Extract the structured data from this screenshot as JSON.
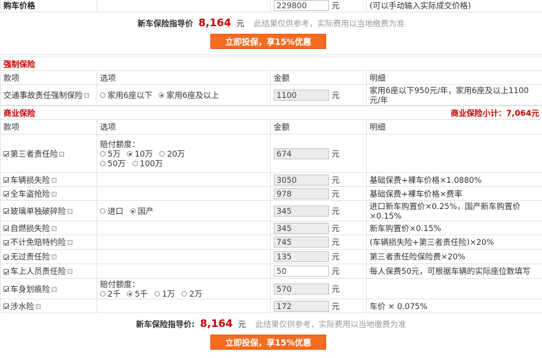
{
  "car_price": {
    "label": "购车价格",
    "value": "229800",
    "unit": "元",
    "hint": "(可以手动输入实际成交价格)"
  },
  "top_banner": {
    "label": "新车保险指导价",
    "price": "8,164",
    "unit": "元",
    "note": "此结果仅供参考，实际费用以当地缴费为准",
    "button": "立即投保，享15%优惠"
  },
  "compulsory": {
    "title": "强制保险",
    "headers": [
      "款项",
      "选项",
      "金额",
      "明细"
    ],
    "name": "交通事故责任强制保险",
    "options": [
      "家用6座以下",
      "家用6座及以上"
    ],
    "selected": 1,
    "amount": "1100",
    "unit": "元",
    "detail": "家用6座以下950元/年，家用6座及以上1100元/年"
  },
  "commercial": {
    "title": "商业保险",
    "subtotal": "商业保险小计：7,064元",
    "headers": [
      "款项",
      "选项",
      "金额",
      "明细"
    ],
    "unit": "元",
    "third_party": {
      "name": "第三者责任险",
      "caption": "赔付额度：",
      "options": [
        "5万",
        "10万",
        "20万",
        "50万",
        "100万"
      ],
      "selected": 1,
      "amount": "674"
    },
    "vehicle_loss": {
      "name": "车辆损失险",
      "amount": "3050",
      "detail": "基础保费+裸车价格×1.0880%"
    },
    "theft": {
      "name": "全车盗抢险",
      "amount": "978",
      "detail": "基础保费+裸车价格×费率"
    },
    "glass": {
      "name": "玻璃单独破碎险",
      "options": [
        "进口",
        "国产"
      ],
      "selected": 1,
      "amount": "345",
      "detail": "进口新车购置价×0.25%，国产新车购置价×0.15%"
    },
    "fire": {
      "name": "自燃损失险",
      "amount": "345",
      "detail": "新车购置价×0.15%"
    },
    "deductible": {
      "name": "不计免赔特约险",
      "amount": "745",
      "detail": "(车辆损失险+第三者责任险)×20%"
    },
    "no_fault": {
      "name": "无过责任险",
      "amount": "135",
      "detail": "第三者责任险保险费×20%"
    },
    "passenger": {
      "name": "车上人员责任险",
      "amount": "50",
      "detail": "每人保费50元，可根据车辆的实际座位数填写"
    },
    "scratch": {
      "name": "车身划痕险",
      "caption": "赔付额度：",
      "options": [
        "2千",
        "5千",
        "1万",
        "2万"
      ],
      "selected": 1,
      "amount": "570"
    },
    "wading": {
      "name": "涉水险",
      "amount": "172",
      "detail": "车价 × 0.075%"
    }
  },
  "bottom_banner": {
    "label": "新车保险指导价:",
    "price": "8,164",
    "unit": "元",
    "note": "此结果仅供参考，实际费用以当地缴费为准",
    "button": "立即投保，享15%优惠"
  }
}
